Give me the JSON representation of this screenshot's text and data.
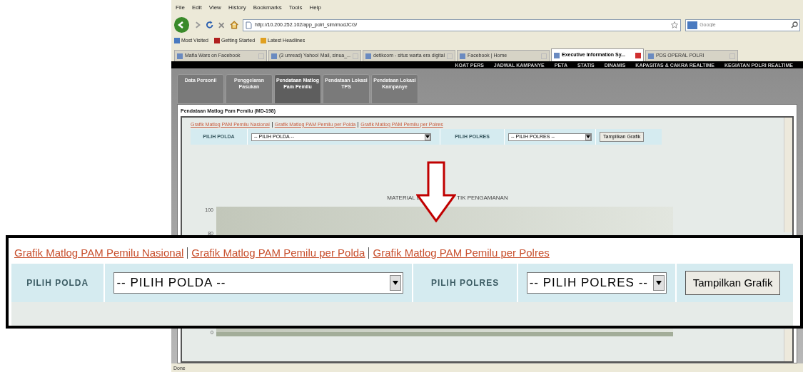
{
  "browser": {
    "menu": [
      "File",
      "Edit",
      "View",
      "History",
      "Bookmarks",
      "Tools",
      "Help"
    ],
    "url": "http://10.200.252.102/app_polri_sim/modJCG/",
    "search": {
      "placeholder": "Google"
    },
    "bookmarks": [
      "Most Visited",
      "Getting Started",
      "Latest Headlines"
    ],
    "tabs": [
      {
        "label": "Mafia Wars on Facebook",
        "selected": false
      },
      {
        "label": "(3 unread) Yahoo! Mail, sinua_...",
        "selected": false
      },
      {
        "label": "detikcom - situs warta era digital",
        "selected": false
      },
      {
        "label": "Facebook | Home",
        "selected": false
      },
      {
        "label": "Executive Information Sy...",
        "selected": true
      },
      {
        "label": "PDS OPERAL POLRI",
        "selected": false
      }
    ],
    "status": "Done"
  },
  "site_nav": [
    "KOAT PERS",
    "JADWAL KAMPANYE",
    "PETA",
    "STATIS",
    "DINAMIS",
    "KAPASITAS & CAKRA REALTIME",
    "KEGIATAN POLRI REALTIME"
  ],
  "page_tabs": [
    {
      "label": "Data Personil",
      "selected": false
    },
    {
      "label": "Penggelaran Pasukan",
      "selected": false
    },
    {
      "label": "Pendataan Matlog Pam Pemilu",
      "selected": true
    },
    {
      "label": "Pendataan Lokasi TPS",
      "selected": false
    },
    {
      "label": "Pendataan Lokasi Kampanye",
      "selected": false
    }
  ],
  "panel": {
    "title": "Pendataan Matlog Pam Pemilu (MD-198)",
    "links": [
      "Grafik Matlog PAM Pemilu Nasional",
      "Grafik Matlog PAM Pemilu per Polda",
      "Grafik Matlog PAM Pemilu per Polres"
    ],
    "filters": [
      {
        "label": "PILIH POLDA",
        "value": "-- PILIH POLDA --"
      },
      {
        "label": "PILIH POLRES",
        "value": "-- PILIH POLRES --"
      }
    ],
    "button": "Tampilkan Grafik",
    "chart": {
      "title_parts": [
        "MATERIAL L",
        "TIK PENGAMANAN"
      ],
      "y_ticks": [
        "100",
        "80",
        "0"
      ]
    }
  },
  "callout": {
    "links": [
      "Grafik Matlog PAM Pemilu Nasional",
      "Grafik Matlog PAM Pemilu per Polda",
      "Grafik Matlog PAM Pemilu per Polres"
    ],
    "filters": [
      {
        "label": "PILIH POLDA",
        "value": "-- PILIH POLDA --"
      },
      {
        "label": "PILIH POLRES",
        "value": "-- PILIH POLRES --"
      }
    ],
    "button": "Tampilkan Grafik"
  }
}
